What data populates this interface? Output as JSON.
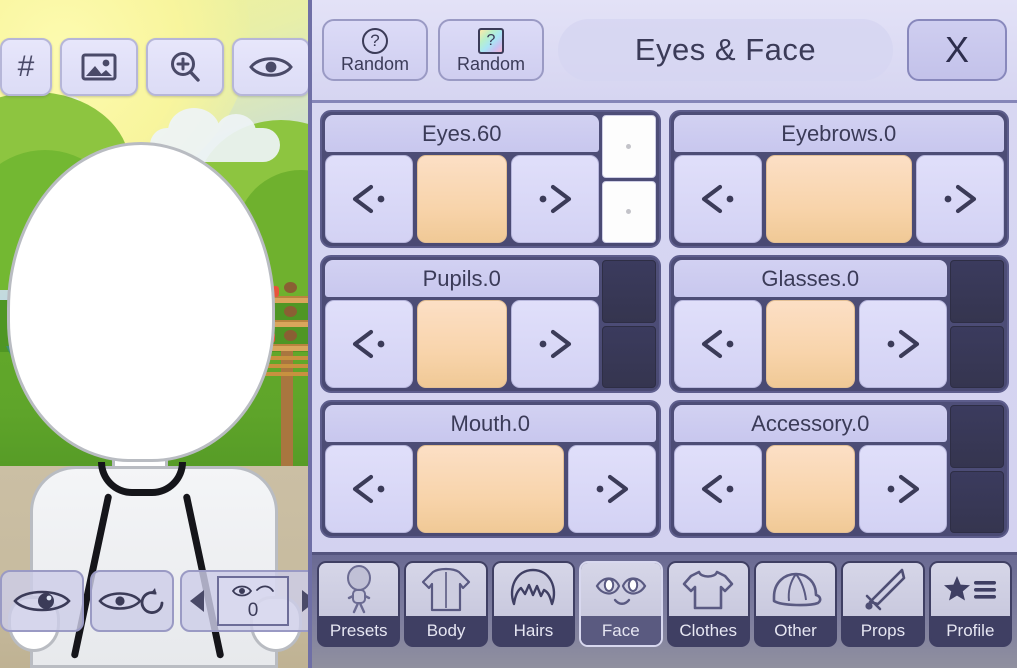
{
  "scene": {
    "name": "character-preview",
    "character_state": "blank white face, white long-sleeve shirt",
    "left_toolbar": [
      {
        "name": "hash-icon",
        "glyph": "#",
        "label": ""
      },
      {
        "name": "image-icon",
        "glyph": "",
        "label": ""
      },
      {
        "name": "zoom-in-icon",
        "glyph": "",
        "label": ""
      },
      {
        "name": "eye-icon",
        "glyph": "",
        "label": ""
      }
    ],
    "bottom_controls": {
      "eye_view_button": "eye-pupil-icon",
      "eye_reset_button": "eye-refresh-icon",
      "stepper": {
        "prev": "triangle-left-icon",
        "next": "triangle-right-icon",
        "preview_icon": "eye-eyebrow-icon",
        "value": "0"
      }
    }
  },
  "header": {
    "random_basic": {
      "label": "Random",
      "icon": "question-circle-icon"
    },
    "random_color": {
      "label": "Random",
      "icon": "question-rainbow-icon"
    },
    "title": "Eyes & Face",
    "close_label": "X"
  },
  "cards": [
    {
      "title": "Eyes.60",
      "prev": "prev-arrow-icon",
      "next": "next-arrow-icon",
      "swatch": "#f8d4ab",
      "side": "white"
    },
    {
      "title": "Eyebrows.0",
      "prev": "prev-arrow-icon",
      "next": "next-arrow-icon",
      "swatch": "#f8d4ab",
      "side": "none"
    },
    {
      "title": "Pupils.0",
      "prev": "prev-arrow-icon",
      "next": "next-arrow-icon",
      "swatch": "#f8d4ab",
      "side": "dark"
    },
    {
      "title": "Glasses.0",
      "prev": "prev-arrow-icon",
      "next": "next-arrow-icon",
      "swatch": "#f8d4ab",
      "side": "dark"
    },
    {
      "title": "Mouth.0",
      "prev": "prev-arrow-icon",
      "next": "next-arrow-icon",
      "swatch": "#f8d4ab",
      "side": "none"
    },
    {
      "title": "Accessory.0",
      "prev": "prev-arrow-icon",
      "next": "next-arrow-icon",
      "swatch": "#f8d4ab",
      "side": "dark"
    }
  ],
  "tabs": [
    {
      "label": "Presets",
      "icon": "body-figure-icon",
      "active": false
    },
    {
      "label": "Body",
      "icon": "torso-icon",
      "active": false
    },
    {
      "label": "Hairs",
      "icon": "hair-icon",
      "active": false
    },
    {
      "label": "Face",
      "icon": "face-icon",
      "active": true
    },
    {
      "label": "Clothes",
      "icon": "tshirt-icon",
      "active": false
    },
    {
      "label": "Other",
      "icon": "cap-icon",
      "active": false
    },
    {
      "label": "Props",
      "icon": "sword-icon",
      "active": false
    },
    {
      "label": "Profile",
      "icon": "star-list-icon",
      "active": false
    }
  ],
  "colors": {
    "panel_bg": "#d6d5f1",
    "card_bg": "#4e4e78",
    "card_title_bg": "#d2d1f2",
    "swatch": "#f8d4ab",
    "text_dark": "#3b3b58",
    "tabbar_bg": "#7e7e9f",
    "accent_border": "#6f6fa6"
  }
}
